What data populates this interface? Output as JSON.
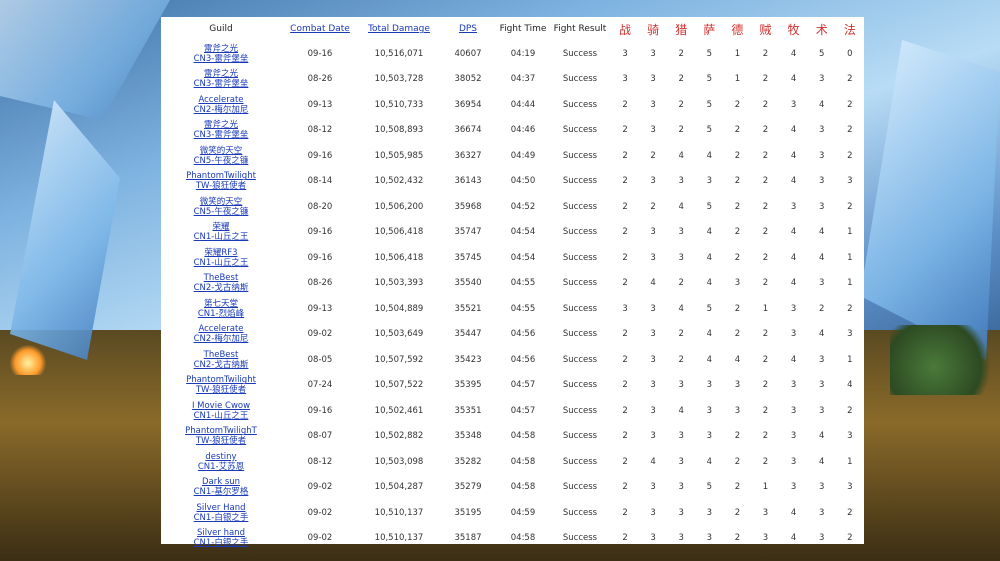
{
  "headers": {
    "guild": "Guild",
    "combat_date": "Combat Date",
    "total_damage": "Total Damage",
    "dps": "DPS",
    "fight_time": "Fight Time",
    "fight_result": "Fight Result",
    "classes": [
      "战",
      "骑",
      "猎",
      "萨",
      "德",
      "贼",
      "牧",
      "术",
      "法"
    ]
  },
  "rows": [
    {
      "guild": "雷斧之光",
      "server": "CN3-雷斧堡垒",
      "date": "09-16",
      "damage": "10,516,071",
      "dps": "40607",
      "time": "04:19",
      "result": "Success",
      "c": [
        "3",
        "3",
        "2",
        "5",
        "1",
        "2",
        "4",
        "5",
        "0"
      ]
    },
    {
      "guild": "雷斧之光",
      "server": "CN3-雷斧堡垒",
      "date": "08-26",
      "damage": "10,503,728",
      "dps": "38052",
      "time": "04:37",
      "result": "Success",
      "c": [
        "3",
        "3",
        "2",
        "5",
        "1",
        "2",
        "4",
        "3",
        "2"
      ]
    },
    {
      "guild": "Accelerate",
      "server": "CN2-梅尔加尼",
      "date": "09-13",
      "damage": "10,510,733",
      "dps": "36954",
      "time": "04:44",
      "result": "Success",
      "c": [
        "2",
        "3",
        "2",
        "5",
        "2",
        "2",
        "3",
        "4",
        "2"
      ]
    },
    {
      "guild": "雷斧之光",
      "server": "CN3-雷斧堡垒",
      "date": "08-12",
      "damage": "10,508,893",
      "dps": "36674",
      "time": "04:46",
      "result": "Success",
      "c": [
        "2",
        "3",
        "2",
        "5",
        "2",
        "2",
        "4",
        "3",
        "2"
      ]
    },
    {
      "guild": "微笑的天空",
      "server": "CN5-午夜之镰",
      "date": "09-16",
      "damage": "10,505,985",
      "dps": "36327",
      "time": "04:49",
      "result": "Success",
      "c": [
        "2",
        "2",
        "4",
        "4",
        "2",
        "2",
        "4",
        "3",
        "2"
      ]
    },
    {
      "guild": "PhantomTwilight",
      "server": "TW-狼狂使者",
      "date": "08-14",
      "damage": "10,502,432",
      "dps": "36143",
      "time": "04:50",
      "result": "Success",
      "c": [
        "2",
        "3",
        "3",
        "3",
        "2",
        "2",
        "4",
        "3",
        "3"
      ]
    },
    {
      "guild": "微笑的天空",
      "server": "CN5-午夜之镰",
      "date": "08-20",
      "damage": "10,506,200",
      "dps": "35968",
      "time": "04:52",
      "result": "Success",
      "c": [
        "2",
        "2",
        "4",
        "5",
        "2",
        "2",
        "3",
        "3",
        "2"
      ]
    },
    {
      "guild": "荣耀",
      "server": "CN1-山丘之王",
      "date": "09-16",
      "damage": "10,506,418",
      "dps": "35747",
      "time": "04:54",
      "result": "Success",
      "c": [
        "2",
        "3",
        "3",
        "4",
        "2",
        "2",
        "4",
        "4",
        "1"
      ]
    },
    {
      "guild": "荣耀RF3",
      "server": "CN1-山丘之王",
      "date": "09-16",
      "damage": "10,506,418",
      "dps": "35745",
      "time": "04:54",
      "result": "Success",
      "c": [
        "2",
        "3",
        "3",
        "4",
        "2",
        "2",
        "4",
        "4",
        "1"
      ]
    },
    {
      "guild": "TheBest",
      "server": "CN2-戈古纳斯",
      "date": "08-26",
      "damage": "10,503,393",
      "dps": "35540",
      "time": "04:55",
      "result": "Success",
      "c": [
        "2",
        "4",
        "2",
        "4",
        "3",
        "2",
        "4",
        "3",
        "1"
      ]
    },
    {
      "guild": "第七天堂",
      "server": "CN1-烈焰峰",
      "date": "09-13",
      "damage": "10,504,889",
      "dps": "35521",
      "time": "04:55",
      "result": "Success",
      "c": [
        "3",
        "3",
        "4",
        "5",
        "2",
        "1",
        "3",
        "2",
        "2"
      ]
    },
    {
      "guild": "Accelerate",
      "server": "CN2-梅尔加尼",
      "date": "09-02",
      "damage": "10,503,649",
      "dps": "35447",
      "time": "04:56",
      "result": "Success",
      "c": [
        "2",
        "3",
        "2",
        "4",
        "2",
        "2",
        "3",
        "4",
        "3"
      ]
    },
    {
      "guild": "TheBest",
      "server": "CN2-戈古纳斯",
      "date": "08-05",
      "damage": "10,507,592",
      "dps": "35423",
      "time": "04:56",
      "result": "Success",
      "c": [
        "2",
        "3",
        "2",
        "4",
        "4",
        "2",
        "4",
        "3",
        "1"
      ]
    },
    {
      "guild": "PhantomTwilight",
      "server": "TW-狼狂使者",
      "date": "07-24",
      "damage": "10,507,522",
      "dps": "35395",
      "time": "04:57",
      "result": "Success",
      "c": [
        "2",
        "3",
        "3",
        "3",
        "3",
        "2",
        "3",
        "3",
        "4"
      ]
    },
    {
      "guild": "I Movie Cwow",
      "server": "CN1-山丘之王",
      "date": "09-16",
      "damage": "10,502,461",
      "dps": "35351",
      "time": "04:57",
      "result": "Success",
      "c": [
        "2",
        "3",
        "4",
        "3",
        "3",
        "2",
        "3",
        "3",
        "2"
      ]
    },
    {
      "guild": "PhantomTwilighT",
      "server": "TW-狼狂使者",
      "date": "08-07",
      "damage": "10,502,882",
      "dps": "35348",
      "time": "04:58",
      "result": "Success",
      "c": [
        "2",
        "3",
        "3",
        "3",
        "2",
        "2",
        "3",
        "4",
        "3"
      ]
    },
    {
      "guild": "destiny",
      "server": "CN1-艾苏恩",
      "date": "08-12",
      "damage": "10,503,098",
      "dps": "35282",
      "time": "04:58",
      "result": "Success",
      "c": [
        "2",
        "4",
        "3",
        "4",
        "2",
        "2",
        "3",
        "4",
        "1"
      ]
    },
    {
      "guild": "Dark sun",
      "server": "CN1-基尔罗格",
      "date": "09-02",
      "damage": "10,504,287",
      "dps": "35279",
      "time": "04:58",
      "result": "Success",
      "c": [
        "2",
        "3",
        "3",
        "5",
        "2",
        "1",
        "3",
        "3",
        "3"
      ]
    },
    {
      "guild": "Silver Hand",
      "server": "CN1-白银之手",
      "date": "09-02",
      "damage": "10,510,137",
      "dps": "35195",
      "time": "04:59",
      "result": "Success",
      "c": [
        "2",
        "3",
        "3",
        "3",
        "2",
        "3",
        "4",
        "3",
        "2"
      ]
    },
    {
      "guild": "Silver hand",
      "server": "CN1-白银之手",
      "date": "09-02",
      "damage": "10,510,137",
      "dps": "35187",
      "time": "04:58",
      "result": "Success",
      "c": [
        "2",
        "3",
        "3",
        "3",
        "2",
        "3",
        "4",
        "3",
        "2"
      ]
    }
  ]
}
